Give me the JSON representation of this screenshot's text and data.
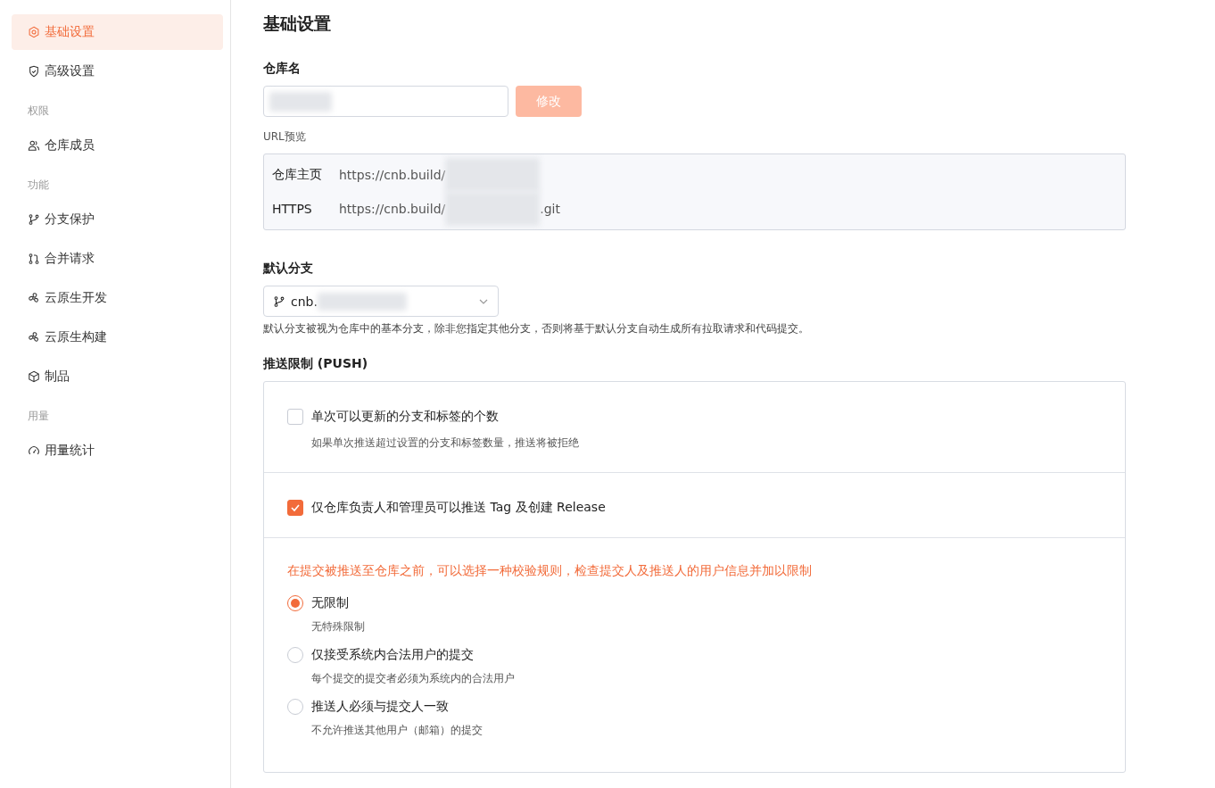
{
  "sidebar": {
    "items": [
      {
        "kind": "item",
        "label": "基础设置",
        "selected": true
      },
      {
        "kind": "item",
        "label": "高级设置",
        "selected": false
      },
      {
        "kind": "group",
        "label": "权限"
      },
      {
        "kind": "item",
        "label": "仓库成员",
        "selected": false
      },
      {
        "kind": "group",
        "label": "功能"
      },
      {
        "kind": "item",
        "label": "分支保护",
        "selected": false
      },
      {
        "kind": "item",
        "label": "合并请求",
        "selected": false
      },
      {
        "kind": "item",
        "label": "云原生开发",
        "selected": false
      },
      {
        "kind": "item",
        "label": "云原生构建",
        "selected": false
      },
      {
        "kind": "item",
        "label": "制品",
        "selected": false
      },
      {
        "kind": "group",
        "label": "用量"
      },
      {
        "kind": "item",
        "label": "用量统计",
        "selected": false
      }
    ]
  },
  "page_title": "基础设置",
  "repo_name": {
    "label": "仓库名",
    "button": "修改",
    "button_disabled": true
  },
  "url_preview": {
    "label": "URL预览",
    "rows": [
      {
        "name": "仓库主页",
        "prefix": "https://cnb.build/",
        "suffix": ""
      },
      {
        "name": "HTTPS",
        "prefix": "https://cnb.build/",
        "suffix": ".git"
      }
    ]
  },
  "default_branch": {
    "label": "默认分支",
    "value": "cnb.",
    "hint": "默认分支被视为仓库中的基本分支，除非您指定其他分支，否则将基于默认分支自动生成所有拉取请求和代码提交。"
  },
  "push_limit": {
    "label": "推送限制 (PUSH)",
    "checks": [
      {
        "label": "单次可以更新的分支和标签的个数",
        "description": "如果单次推送超过设置的分支和标签数量，推送将被拒绝",
        "checked": false
      },
      {
        "label": "仅仓库负责人和管理员可以推送 Tag 及创建 Release",
        "checked": true
      }
    ],
    "rule_note": "在提交被推送至仓库之前，可以选择一种校验规则，检查提交人及推送人的用户信息并加以限制",
    "options": [
      {
        "label": "无限制",
        "description": "无特殊限制",
        "selected": true
      },
      {
        "label": "仅接受系统内合法用户的提交",
        "description": "每个提交的提交者必须为系统内的合法用户",
        "selected": false
      },
      {
        "label": "推送人必须与提交人一致",
        "description": "不允许推送其他用户（邮箱）的提交",
        "selected": false
      }
    ]
  }
}
